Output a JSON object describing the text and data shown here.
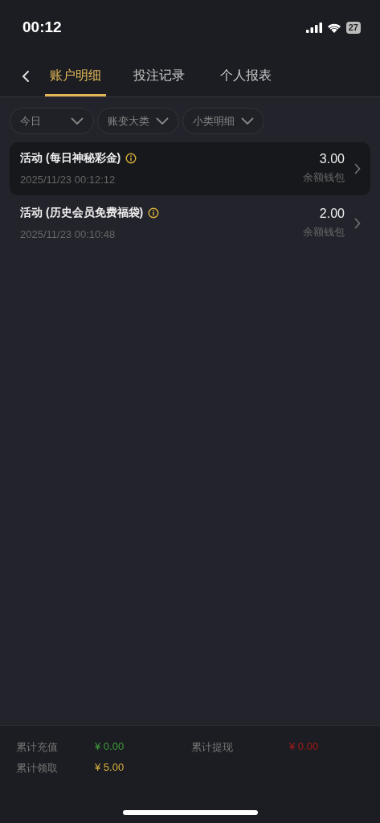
{
  "status_bar": {
    "time": "00:12",
    "battery": "27"
  },
  "tabs": [
    {
      "label": "账户明细",
      "selected": true
    },
    {
      "label": "投注记录",
      "selected": false
    },
    {
      "label": "个人报表",
      "selected": false
    }
  ],
  "filters": [
    {
      "label": "今日"
    },
    {
      "label": "账变大类"
    },
    {
      "label": "小类明细"
    }
  ],
  "records": [
    {
      "title": "活动 (每日神秘彩金)",
      "time": "2025/11/23 00:12:12",
      "amount": "3.00",
      "wallet": "余额钱包",
      "selected": true
    },
    {
      "title": "活动 (历史会员免费福袋)",
      "time": "2025/11/23 00:10:48",
      "amount": "2.00",
      "wallet": "余额钱包",
      "selected": false
    }
  ],
  "summary": [
    {
      "label": "累计充值",
      "value": "¥ 0.00",
      "color": "#3f9a3a"
    },
    {
      "label": "累计提现",
      "value": "¥ 0.00",
      "color": "#a31a1a"
    },
    {
      "label": "累计领取",
      "value": "¥ 5.00",
      "color": "#d9b13d"
    }
  ]
}
